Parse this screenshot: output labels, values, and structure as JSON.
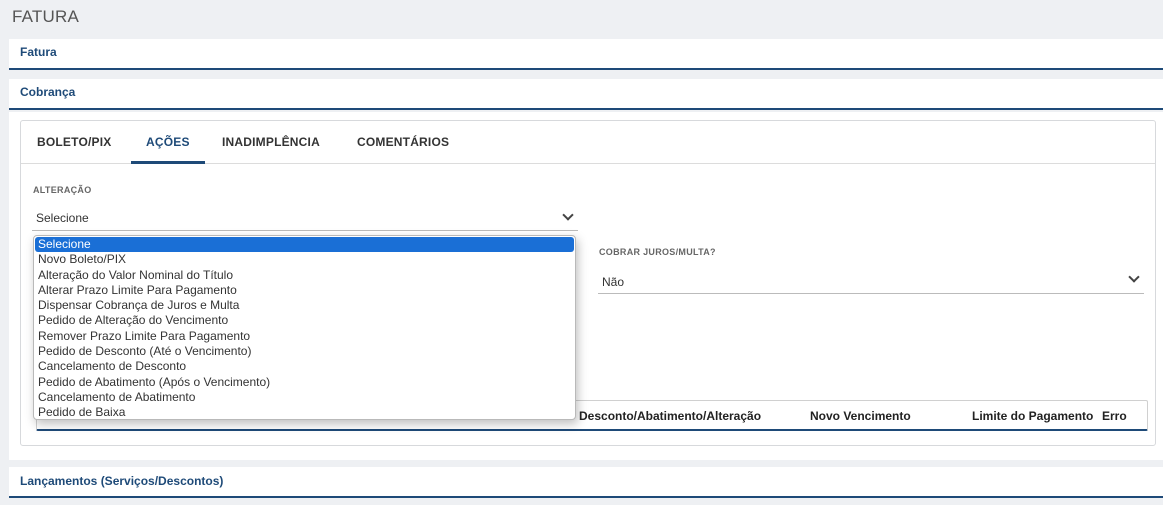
{
  "page": {
    "title": "FATURA"
  },
  "panels": {
    "fatura": "Fatura",
    "cobranca": "Cobrança",
    "lancamentos": "Lançamentos (Serviços/Descontos)"
  },
  "tabs": [
    {
      "label": "BOLETO/PIX"
    },
    {
      "label": "AÇÕES"
    },
    {
      "label": "INADIMPLÊNCIA"
    },
    {
      "label": "COMENTÁRIOS"
    }
  ],
  "active_tab": "AÇÕES",
  "alteracao": {
    "label": "ALTERAÇÃO",
    "value": "Selecione",
    "options": [
      "Selecione",
      "Novo Boleto/PIX",
      "Alteração do Valor Nominal do Título",
      "Alterar Prazo Limite Para Pagamento",
      "Dispensar Cobrança de Juros e Multa",
      "Pedido de Alteração do Vencimento",
      "Remover Prazo Limite Para Pagamento",
      "Pedido de Desconto (Até o Vencimento)",
      "Cancelamento de Desconto",
      "Pedido de Abatimento (Após o Vencimento)",
      "Cancelamento de Abatimento",
      "Pedido de Baixa"
    ]
  },
  "cobrar_juros": {
    "label": "COBRAR JUROS/MULTA?",
    "value": "Não"
  },
  "table": {
    "columns": [
      "Desconto/Abatimento/Alteração",
      "Novo Vencimento",
      "Limite do Pagamento",
      "Erro"
    ]
  }
}
